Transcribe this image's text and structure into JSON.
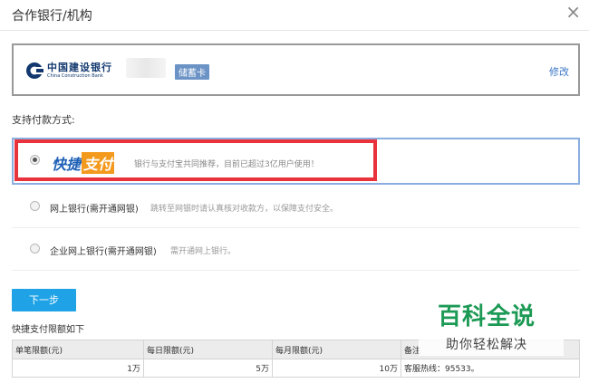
{
  "window": {
    "title": "合作银行/机构",
    "close_symbol": "×"
  },
  "bank": {
    "name_cn": "中国建设银行",
    "name_en": "China Construction Bank",
    "card_type": "储蓄卡",
    "modify_label": "修改",
    "brand_color": "#12386f"
  },
  "payment": {
    "label": "支持付款方式:",
    "options": [
      {
        "name_part1": "快捷",
        "name_part2": "支付",
        "desc": "银行与支付宝共同推荐，目前已超过3亿用户使用！",
        "selected": true
      },
      {
        "name": "网上银行(需开通网银)",
        "desc": "跳转至网银时请认真核对收款方，以保障支付安全。",
        "selected": false
      },
      {
        "name": "企业网上银行(需开通网银)",
        "desc": "需开通网上银行。",
        "selected": false
      }
    ]
  },
  "next_button": {
    "label": "下一步",
    "color": "#1fa3e6"
  },
  "limits": {
    "title": "快捷支付限额如下",
    "headers": [
      "单笔限额(元)",
      "每日限额(元)",
      "每月限额(元)",
      "备注"
    ],
    "row": [
      "1万",
      "5万",
      "10万",
      "客服热线：95533。"
    ]
  },
  "watermark": {
    "main": "百科全说",
    "sub": "助你轻松解决",
    "color": "#1c9a55"
  },
  "highlight_color": "#e8323c"
}
